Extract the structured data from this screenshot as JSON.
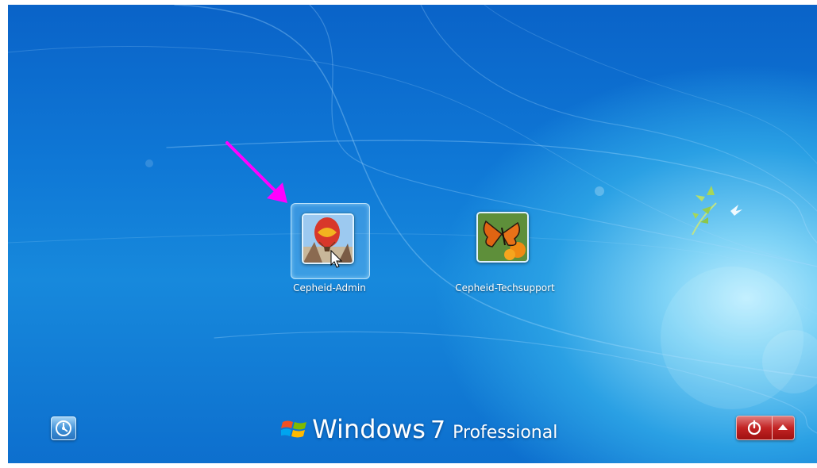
{
  "users": [
    {
      "name": "Cepheid-Admin",
      "picture": "hot-air-balloon-picture",
      "selected": true
    },
    {
      "name": "Cepheid-Techsupport",
      "picture": "butterfly-picture",
      "selected": false
    }
  ],
  "branding": {
    "product": "Windows",
    "version": "7",
    "edition": "Professional"
  },
  "controls": {
    "ease_of_access_icon": "ease-of-access-icon",
    "shutdown_icon": "power-icon",
    "shutdown_options_icon": "arrow-up-icon"
  },
  "annotation": {
    "arrow_color": "#ff00ff"
  },
  "colors": {
    "background": "#0f78d6",
    "shutdown": "#c22323"
  }
}
